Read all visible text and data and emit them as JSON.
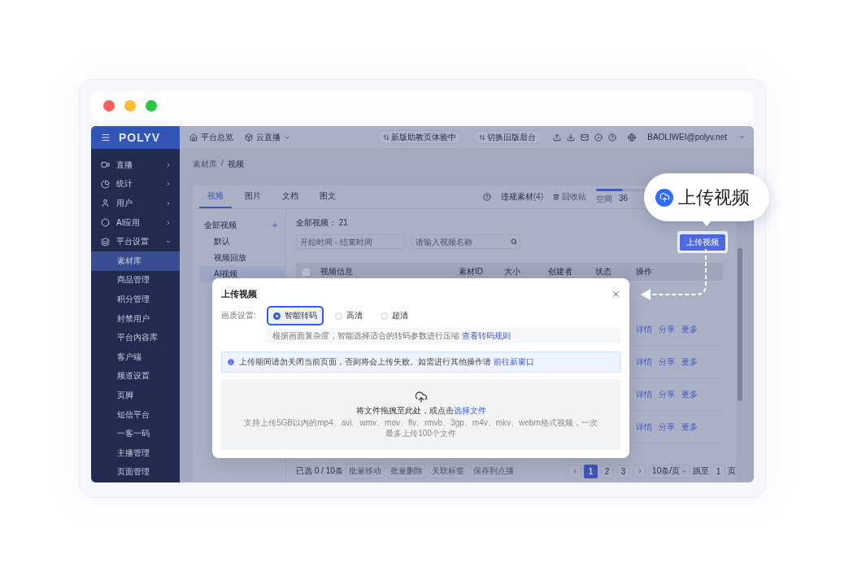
{
  "browser": {
    "dots": [
      {
        "color": "#ff5f57"
      },
      {
        "color": "#febc2e"
      },
      {
        "color": "#28c840"
      }
    ]
  },
  "logo": "POLYV",
  "topnav": [
    {
      "label": "平台总览",
      "dropdown": false
    },
    {
      "label": "云直播",
      "dropdown": true
    }
  ],
  "header_buttons": [
    "新版助教页体验中",
    "切换旧版后台"
  ],
  "user": "BAOLIWEI@polyv.net",
  "sidebar": [
    {
      "label": "直播",
      "expanded": false
    },
    {
      "label": "统计",
      "expanded": false
    },
    {
      "label": "用户",
      "expanded": false
    },
    {
      "label": "AI应用",
      "expanded": false
    },
    {
      "label": "平台设置",
      "expanded": true,
      "children": [
        {
          "label": "素材库",
          "selected": true
        },
        {
          "label": "商品管理",
          "selected": false
        },
        {
          "label": "积分管理",
          "selected": false
        },
        {
          "label": "封禁用户",
          "selected": false
        },
        {
          "label": "平台内容库",
          "selected": false
        },
        {
          "label": "客户端",
          "selected": false
        },
        {
          "label": "频道设置",
          "selected": false
        },
        {
          "label": "页脚",
          "selected": false
        },
        {
          "label": "短信平台",
          "selected": false
        },
        {
          "label": "一客一码",
          "selected": false
        },
        {
          "label": "主播管理",
          "selected": false
        },
        {
          "label": "页面管理",
          "selected": false
        }
      ]
    }
  ],
  "breadcrumb": [
    "素材库",
    "视频"
  ],
  "breadcrumb_separator": "/",
  "select_all": {
    "checked": false
  },
  "tabs": [
    {
      "label": "视频",
      "selected": true
    },
    {
      "label": "图片",
      "selected": false
    },
    {
      "label": "文档",
      "selected": false
    },
    {
      "label": "图文",
      "selected": false
    }
  ],
  "violations": {
    "label": "违规素材",
    "count": "(4)"
  },
  "recycle": "回收站",
  "storage": {
    "label": "空间",
    "value": "36",
    "level": 0.55
  },
  "folders": {
    "label": "全部视频",
    "children": [
      {
        "label": "默认",
        "selected": false
      },
      {
        "label": "视频回放",
        "selected": false
      },
      {
        "label": "AI视频",
        "selected": true
      }
    ]
  },
  "total": {
    "label": "全部视频：",
    "value": "21"
  },
  "filters": {
    "date_placeholder": "开始时间 - 结束时间",
    "search_placeholder": "请输入视频名称"
  },
  "upload_button": "上传视频",
  "table": {
    "columns": [
      "视频信息",
      "素材ID",
      "大小",
      "创建者",
      "状态",
      "操作"
    ],
    "rows": [
      {
        "actions": [
          "详情",
          "分享",
          "更多"
        ]
      },
      {
        "actions": [
          "详情",
          "分享",
          "更多"
        ]
      },
      {
        "actions": [
          "详情",
          "分享",
          "更多"
        ]
      },
      {
        "actions": [
          "详情",
          "分享",
          "更多"
        ]
      }
    ]
  },
  "footer": {
    "selected": "已选 0 / 10条",
    "buttons": [
      "批量移动",
      "批量删除",
      "关联标签",
      "保存到点播"
    ],
    "pages": [
      {
        "label": "1",
        "selected": true
      },
      {
        "label": "2",
        "selected": false
      },
      {
        "label": "3",
        "selected": false
      }
    ],
    "page_size": "10条/页",
    "jump": "跳至",
    "jump_value": "1",
    "page_unit": "页"
  },
  "dialog": {
    "title": "上传视频",
    "quality_label": "画质设置:",
    "options": [
      {
        "label": "智能转码",
        "selected": true
      },
      {
        "label": "高清",
        "selected": false
      },
      {
        "label": "超清",
        "selected": false
      }
    ],
    "hint": "根据画面复杂度，智能选择适合的转码参数进行压缩",
    "hint_link": "查看转码规则",
    "notice": "上传期间请勿关闭当前页面，否则将会上传失败。如需进行其他操作请",
    "notice_link": "前往新窗口",
    "drop_text": "将文件拖拽至此处，或点击",
    "drop_link": "选择文件",
    "formats": "支持上传5GB以内的mp4、avi、wmv、mov、flv、rmvb、3gp、m4v、mkv、webm格式视频，一次最多上传100个文件"
  },
  "callout": "上传视频"
}
